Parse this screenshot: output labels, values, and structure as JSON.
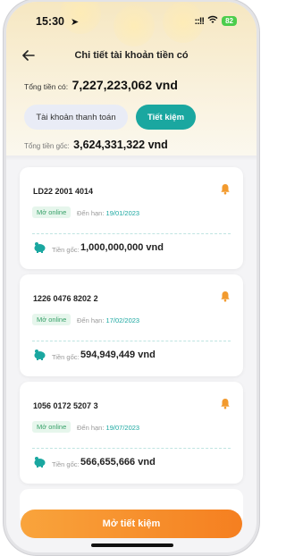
{
  "status_bar": {
    "time": "15:30",
    "signal": "::!!",
    "battery": "82"
  },
  "nav": {
    "title": "Chi tiết tài khoản tiền có"
  },
  "summary": {
    "total_label": "Tổng tiền có:",
    "total_value": "7,227,223,062 vnd",
    "principal_label": "Tổng tiền gốc:",
    "principal_value": "3,624,331,322 vnd"
  },
  "tabs": [
    {
      "label": "Tài khoản thanh toán",
      "active": false
    },
    {
      "label": "Tiết kiệm",
      "active": true
    }
  ],
  "accounts": [
    {
      "number": "LD22 2001 4014",
      "status": "Mở online",
      "due_label": "Đến hạn:",
      "due_date": "19/01/2023",
      "principal_label": "Tiền gốc:",
      "principal": "1,000,000,000 vnd"
    },
    {
      "number": "1226 0476 8202 2",
      "status": "Mở online",
      "due_label": "Đến hạn:",
      "due_date": "17/02/2023",
      "principal_label": "Tiền gốc:",
      "principal": "594,949,449 vnd"
    },
    {
      "number": "1056 0172 5207 3",
      "status": "Mở online",
      "due_label": "Đến hạn:",
      "due_date": "19/07/2023",
      "principal_label": "Tiền gốc:",
      "principal": "566,655,666 vnd"
    }
  ],
  "cta": {
    "label": "Mở tiết kiệm"
  },
  "colors": {
    "accent": "#1aa7a0",
    "cta_start": "#f9a43c",
    "cta_end": "#f57f20",
    "bell": "#f29a2e"
  },
  "icons": {
    "back": "arrow-left-icon",
    "bell": "bell-icon",
    "piggy": "piggy-bank-icon",
    "wifi": "wifi-icon",
    "location": "location-arrow-icon"
  }
}
